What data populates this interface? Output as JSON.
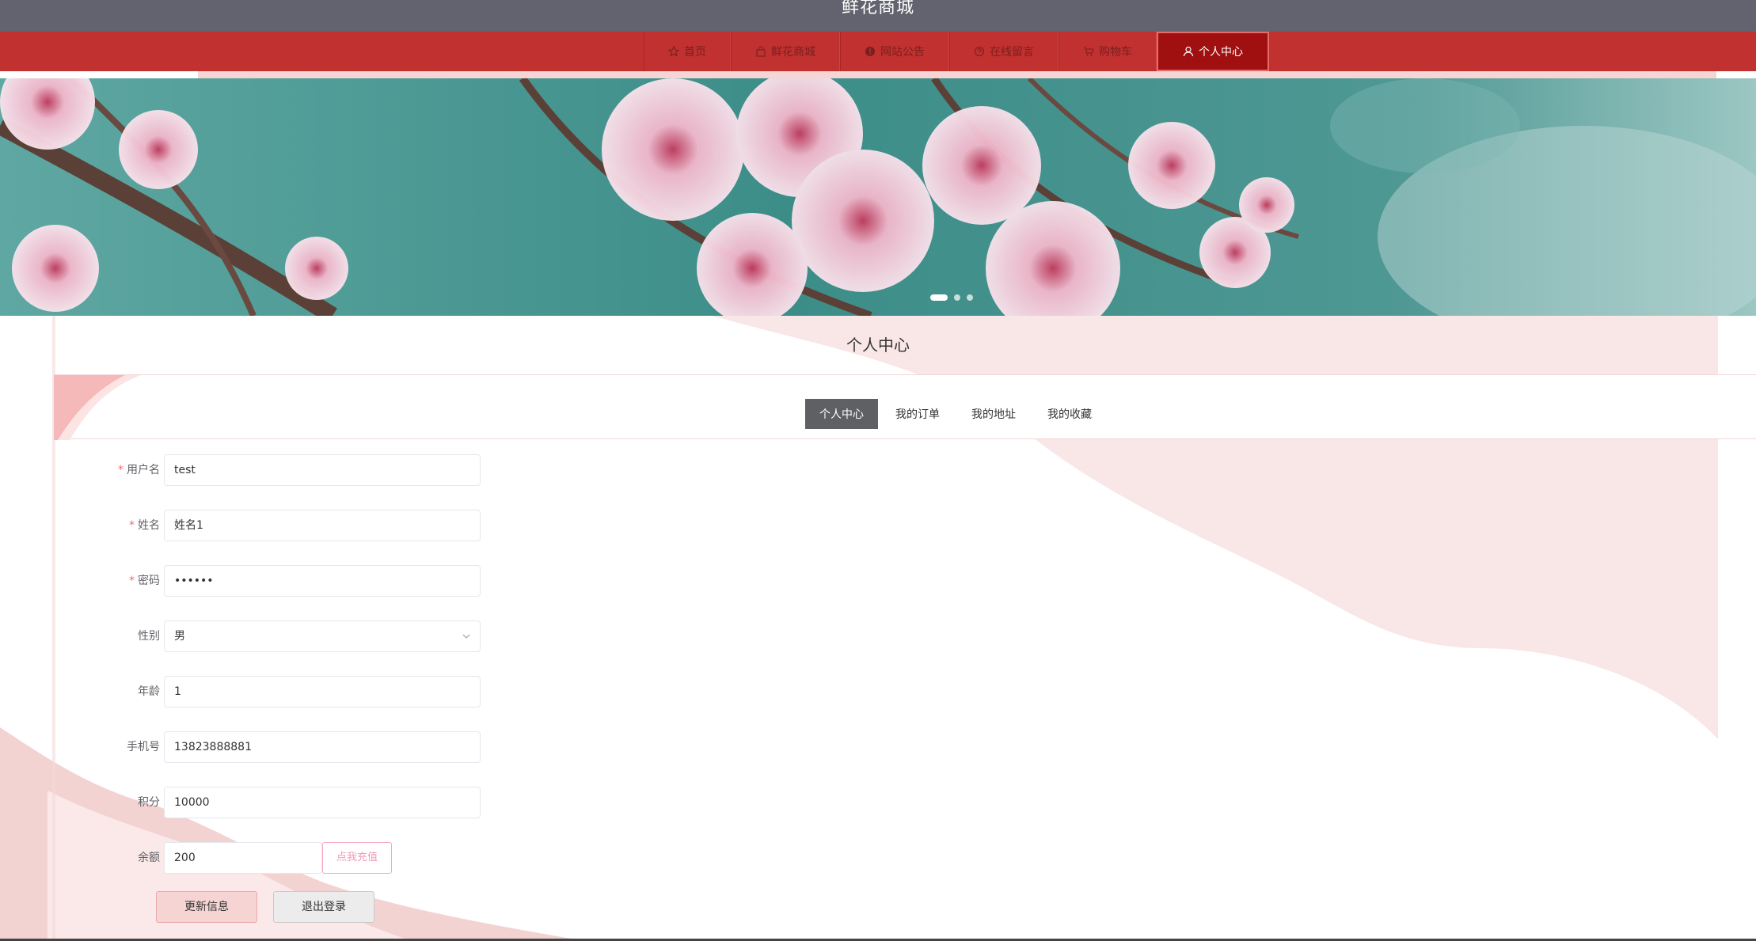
{
  "site_title": "鲜花商城",
  "nav": {
    "items": [
      {
        "label": "首页",
        "icon": "star-icon"
      },
      {
        "label": "鲜花商城",
        "icon": "bag-icon"
      },
      {
        "label": "网站公告",
        "icon": "info-icon"
      },
      {
        "label": "在线留言",
        "icon": "message-icon"
      },
      {
        "label": "购物车",
        "icon": "cart-icon"
      },
      {
        "label": "个人中心",
        "icon": "user-icon",
        "active": true
      }
    ]
  },
  "banner": {
    "slides": 3,
    "active_slide": 1
  },
  "page_title": "个人中心",
  "tabs": [
    {
      "label": "个人中心",
      "active": true
    },
    {
      "label": "我的订单"
    },
    {
      "label": "我的地址"
    },
    {
      "label": "我的收藏"
    }
  ],
  "form": {
    "username": {
      "label": "用户名",
      "value": "test",
      "required": true
    },
    "name": {
      "label": "姓名",
      "value": "姓名1",
      "required": true
    },
    "password": {
      "label": "密码",
      "value": "••••••",
      "required": true
    },
    "gender": {
      "label": "性别",
      "value": "男"
    },
    "age": {
      "label": "年龄",
      "value": "1"
    },
    "phone": {
      "label": "手机号",
      "value": "13823888881"
    },
    "points": {
      "label": "积分",
      "value": "10000"
    },
    "balance": {
      "label": "余额",
      "value": "200",
      "recharge_label": "点我充值"
    }
  },
  "buttons": {
    "update": "更新信息",
    "logout": "退出登录"
  },
  "colors": {
    "nav_bg": "#c0312f",
    "nav_active": "#a01010",
    "title_bar": "#62636f",
    "accent_pink": "#f39ab3",
    "required": "#f56c6c"
  }
}
